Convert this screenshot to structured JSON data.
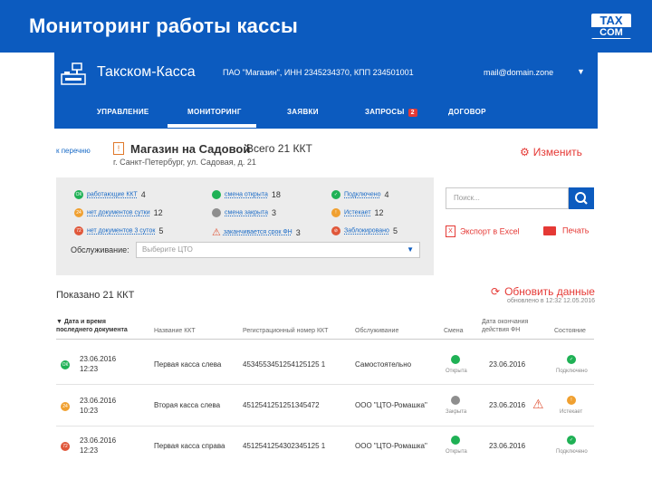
{
  "slide": {
    "title": "Мониторинг работы кассы",
    "logo_top": "TAX",
    "logo_bottom": "COM"
  },
  "app": {
    "name": "Такском-Касса",
    "org_info": "ПАО \"Магазин\", ИНН 2345234370, КПП 234501001",
    "user_email": "mail@domain.zone",
    "nav": [
      {
        "label": "УПРАВЛЕНИЕ"
      },
      {
        "label": "МОНИТОРИНГ"
      },
      {
        "label": "ЗАЯВКИ"
      },
      {
        "label": "ЗАПРОСЫ",
        "badge": "2"
      },
      {
        "label": "ДОГОВОР"
      }
    ]
  },
  "store": {
    "breadcrumb": "к перечню",
    "icon": "!",
    "name": "Магазин на Садовой",
    "total": "Всего 21 ККТ",
    "address": "г. Санкт-Петербург, ул. Садовая, д. 21",
    "edit_label": "Изменить"
  },
  "status": {
    "col1": [
      {
        "label": "работающие ККТ",
        "count": "4",
        "badge": "ОК"
      },
      {
        "label": "нет документов сутки",
        "count": "12",
        "badge": "24"
      },
      {
        "label": "нет документов 3 суток",
        "count": "5",
        "badge": "72"
      }
    ],
    "col2": [
      {
        "label": "смена открыта",
        "count": "18"
      },
      {
        "label": "смена закрыта",
        "count": "3"
      },
      {
        "label": "заканчивается срок ФН",
        "count": "3"
      }
    ],
    "col3": [
      {
        "label": "Подключено",
        "count": "4"
      },
      {
        "label": "Истекает",
        "count": "12"
      },
      {
        "label": "Заблокировано",
        "count": "5"
      }
    ],
    "service_label": "Обслуживание:",
    "service_placeholder": "Выберите ЦТО"
  },
  "search": {
    "placeholder": "Поиск..."
  },
  "actions": {
    "export": "Экспорт в Excel",
    "print": "Печать"
  },
  "list": {
    "shown": "Показано 21 ККТ",
    "refresh": "Обновить данные",
    "refresh_note": "обновлено в 12:32 12.05.2016"
  },
  "table": {
    "headers": {
      "date_line1": "Дата и время",
      "date_line2": "последнего документа",
      "name": "Название ККТ",
      "reg": "Регистрационный номер ККТ",
      "service": "Обслуживание",
      "shift": "Смена",
      "fn_line1": "Дата окончания",
      "fn_line2": "действия ФН",
      "state": "Состояние"
    },
    "rows": [
      {
        "badge": "ОК",
        "date": "23.06.2016",
        "time": "12:23",
        "name": "Первая касса слева",
        "reg": "4534553451254125125 1",
        "service": "Самостоятельно",
        "shift": "Открыта",
        "fn_date": "23.06.2016",
        "state": "Подключено"
      },
      {
        "badge": "24",
        "date": "23.06.2016",
        "time": "10:23",
        "name": "Вторая касса слева",
        "reg": "4512541251251345472",
        "service": "ООО \"ЦТО-Ромашка\"",
        "shift": "Закрыта",
        "fn_date": "23.06.2016",
        "state": "Истекает"
      },
      {
        "badge": "72",
        "date": "23.06.2016",
        "time": "12:23",
        "name": "Первая касса справа",
        "reg": "4512541254302345125 1",
        "service": "ООО \"ЦТО-Ромашка\"",
        "shift": "Открыта",
        "fn_date": "23.06.2016",
        "state": "Подключено"
      }
    ]
  },
  "colors": {
    "brand_blue": "#0c5bbf",
    "accent_red": "#e53935",
    "ok_green": "#1fb155",
    "warn_orange": "#f0a030",
    "crit_red": "#e0573a",
    "closed_grey": "#8e8e8e"
  }
}
